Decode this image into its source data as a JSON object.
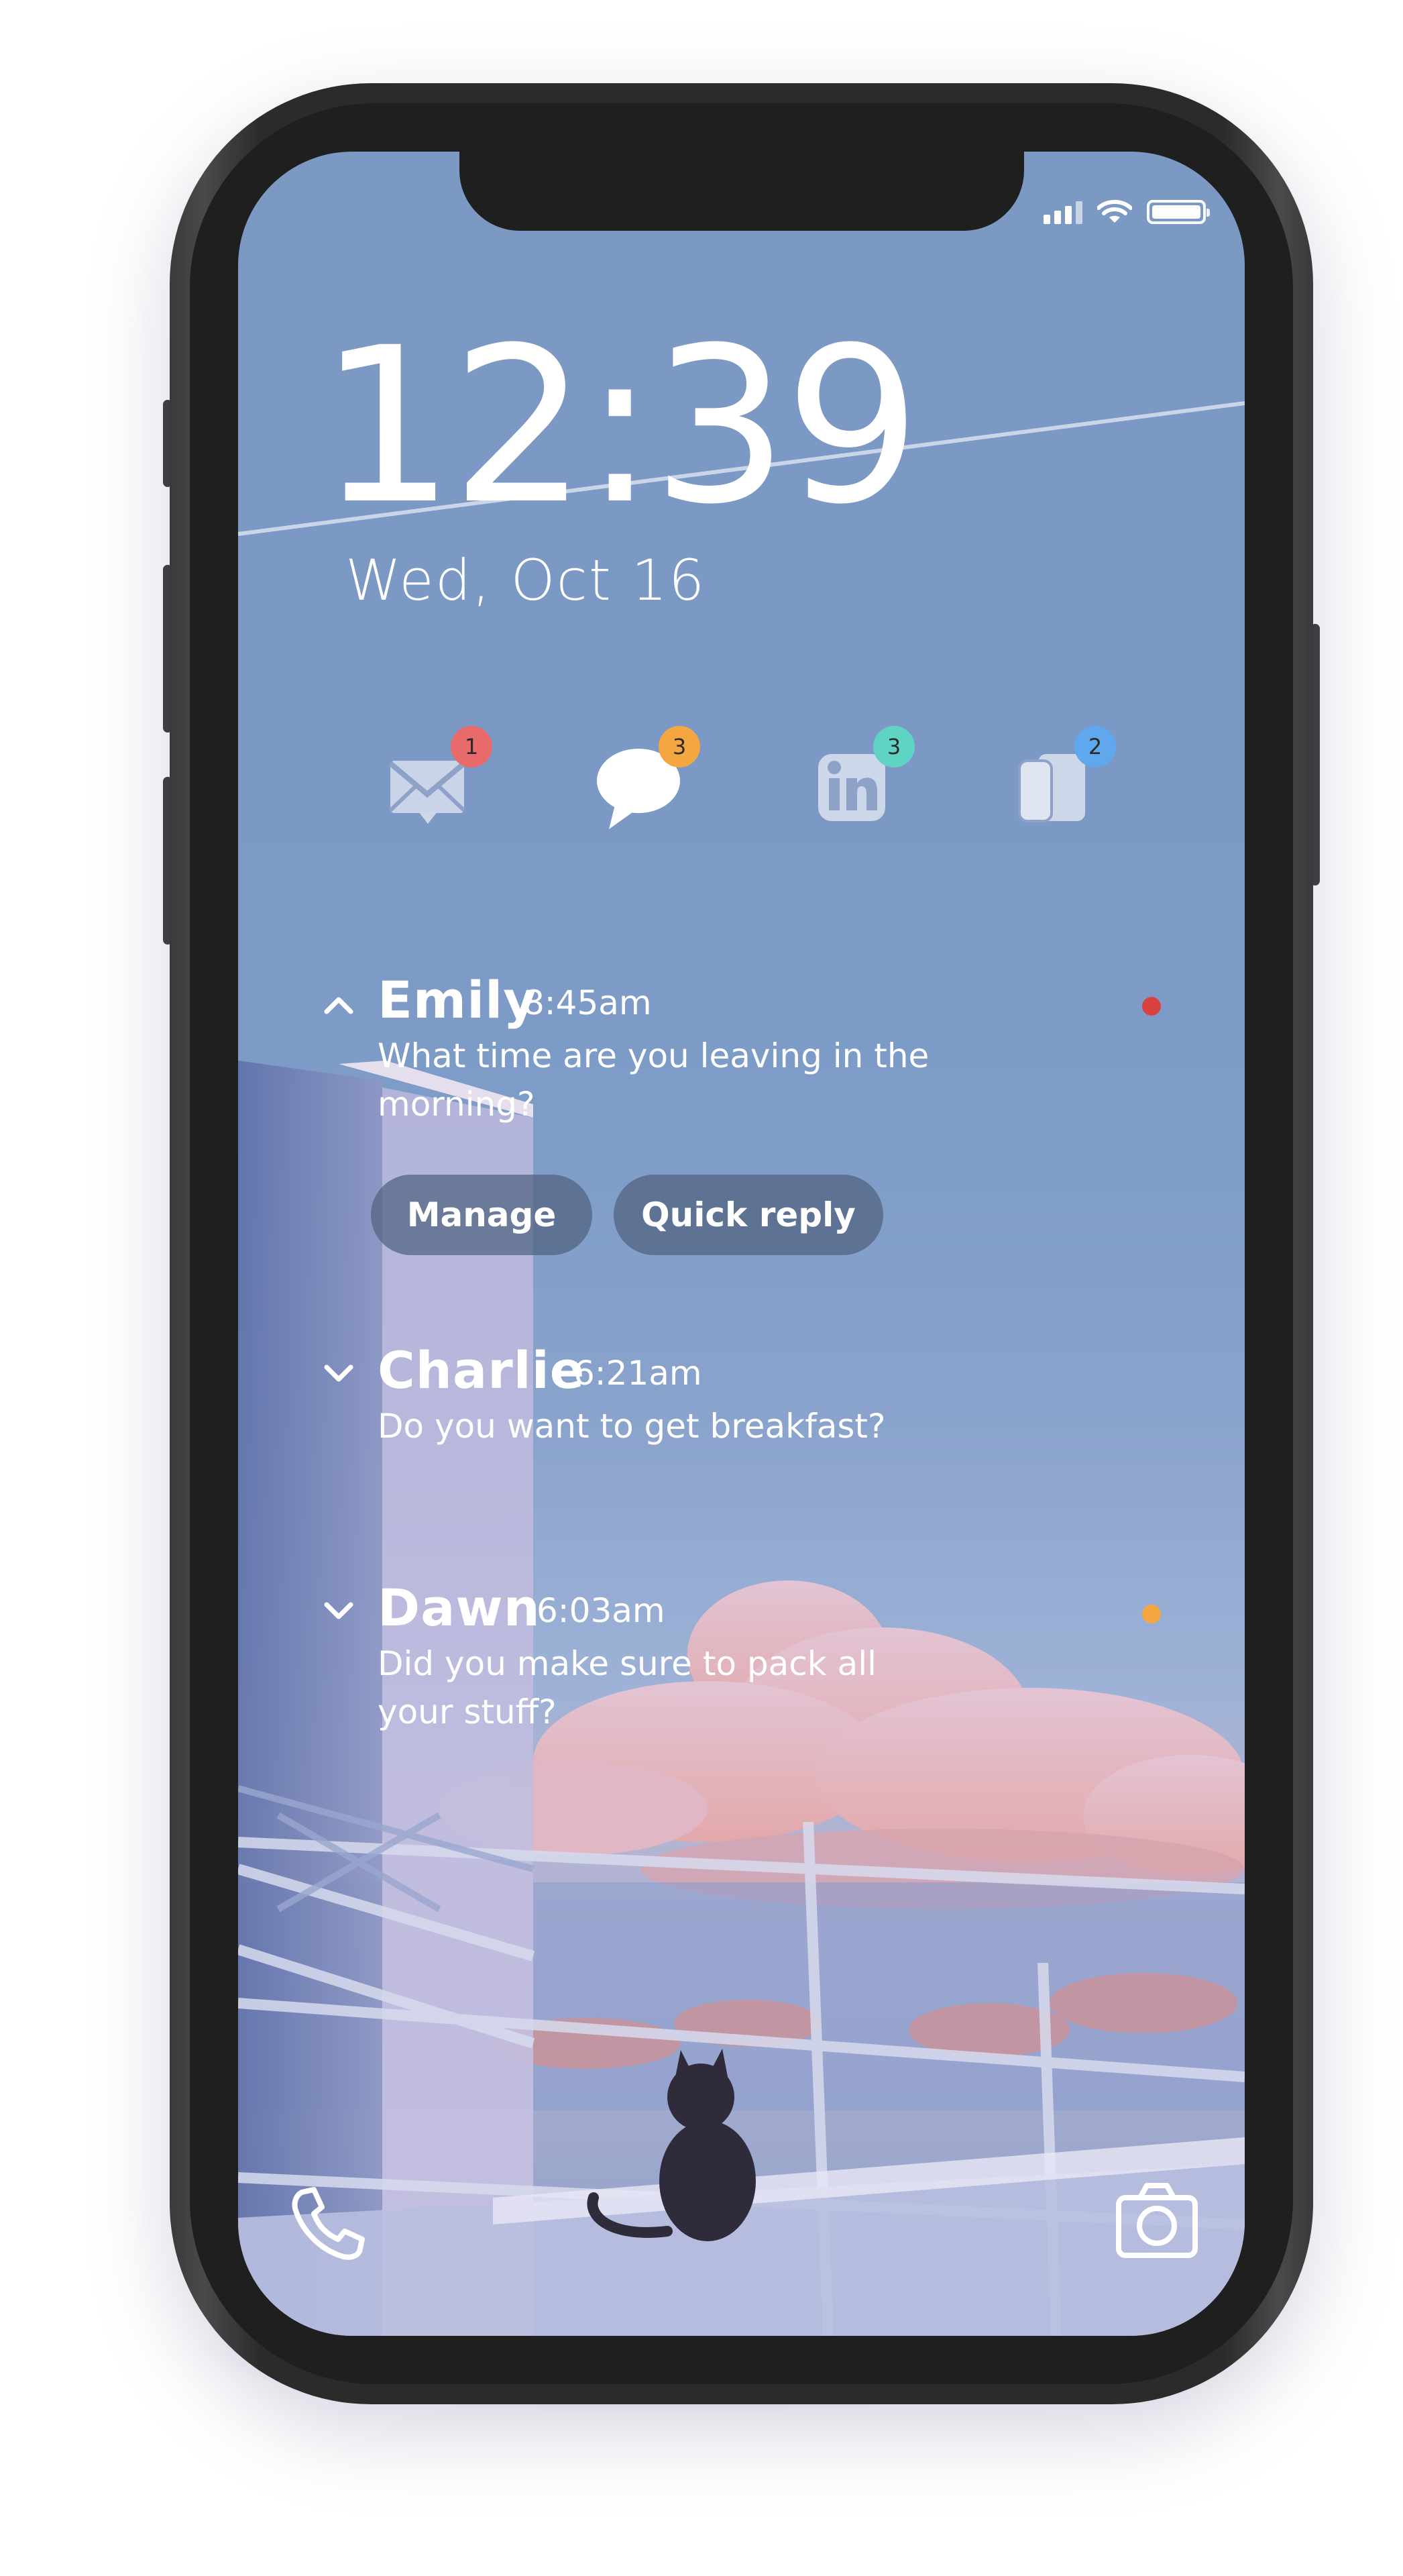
{
  "status_bar": {
    "signal_icon": "signal-bars-icon",
    "wifi_icon": "wifi-icon",
    "battery_icon": "battery-icon",
    "battery_level": 1.0
  },
  "lock_screen": {
    "time": "12:39",
    "date": "Wed, Oct 16"
  },
  "apps": [
    {
      "icon": "mail-icon",
      "badge": "1",
      "badge_color": "#e86a6a"
    },
    {
      "icon": "message-bubble-icon",
      "badge": "3",
      "badge_color": "#f4a640"
    },
    {
      "icon": "linkedin-icon",
      "badge": "3",
      "badge_color": "#5fd3c4"
    },
    {
      "icon": "cards-app-icon",
      "badge": "2",
      "badge_color": "#5fa8ee"
    }
  ],
  "notifications": [
    {
      "name": "Emily",
      "time": "8:45am",
      "message": "What time are you leaving in the morning?",
      "expanded": true,
      "dot_color": "#d9433f",
      "actions": [
        "Manage",
        "Quick reply"
      ]
    },
    {
      "name": "Charlie",
      "time": "6:21am",
      "message": "Do you want to get breakfast?",
      "expanded": false
    },
    {
      "name": "Dawn",
      "time": "6:03am",
      "message": "Did you make sure to pack all your stuff?",
      "expanded": false,
      "dot_color": "#f4a640"
    }
  ],
  "shortcuts": {
    "left": "phone-icon",
    "right": "camera-icon"
  }
}
